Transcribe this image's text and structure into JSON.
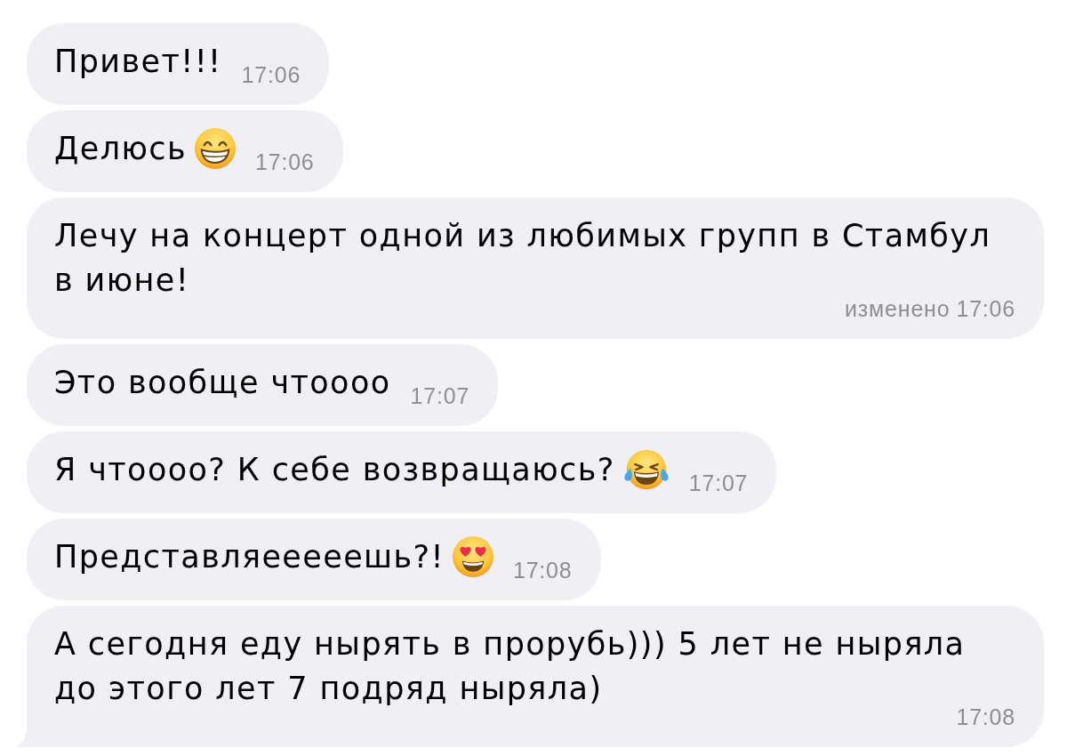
{
  "messages": [
    {
      "text": "Привет!!!",
      "time": "17:06",
      "tail": false
    },
    {
      "text": "Делюсь",
      "emoji": {
        "kind": "grinning"
      },
      "time": "17:06",
      "tail": false
    },
    {
      "text": "Лечу на концерт одной из любимых групп в Стамбул в июне!",
      "edited_label": "изменено",
      "time": "17:06",
      "tail": false
    },
    {
      "text": "Это вообще чтоооо",
      "time": "17:07",
      "tail": false
    },
    {
      "text": "Я чтоооо? К себе возвращаюсь?",
      "emoji": {
        "kind": "tears_of_joy"
      },
      "time": "17:07",
      "tail": false
    },
    {
      "text": "Представляееееешь?!",
      "emoji": {
        "kind": "heart_eyes"
      },
      "time": "17:08",
      "tail": false
    },
    {
      "text": "А сегодня еду нырять в прорубь))) 5 лет не ныряла до этого лет 7 подряд ныряла)",
      "time": "17:08",
      "tail": true
    }
  ]
}
